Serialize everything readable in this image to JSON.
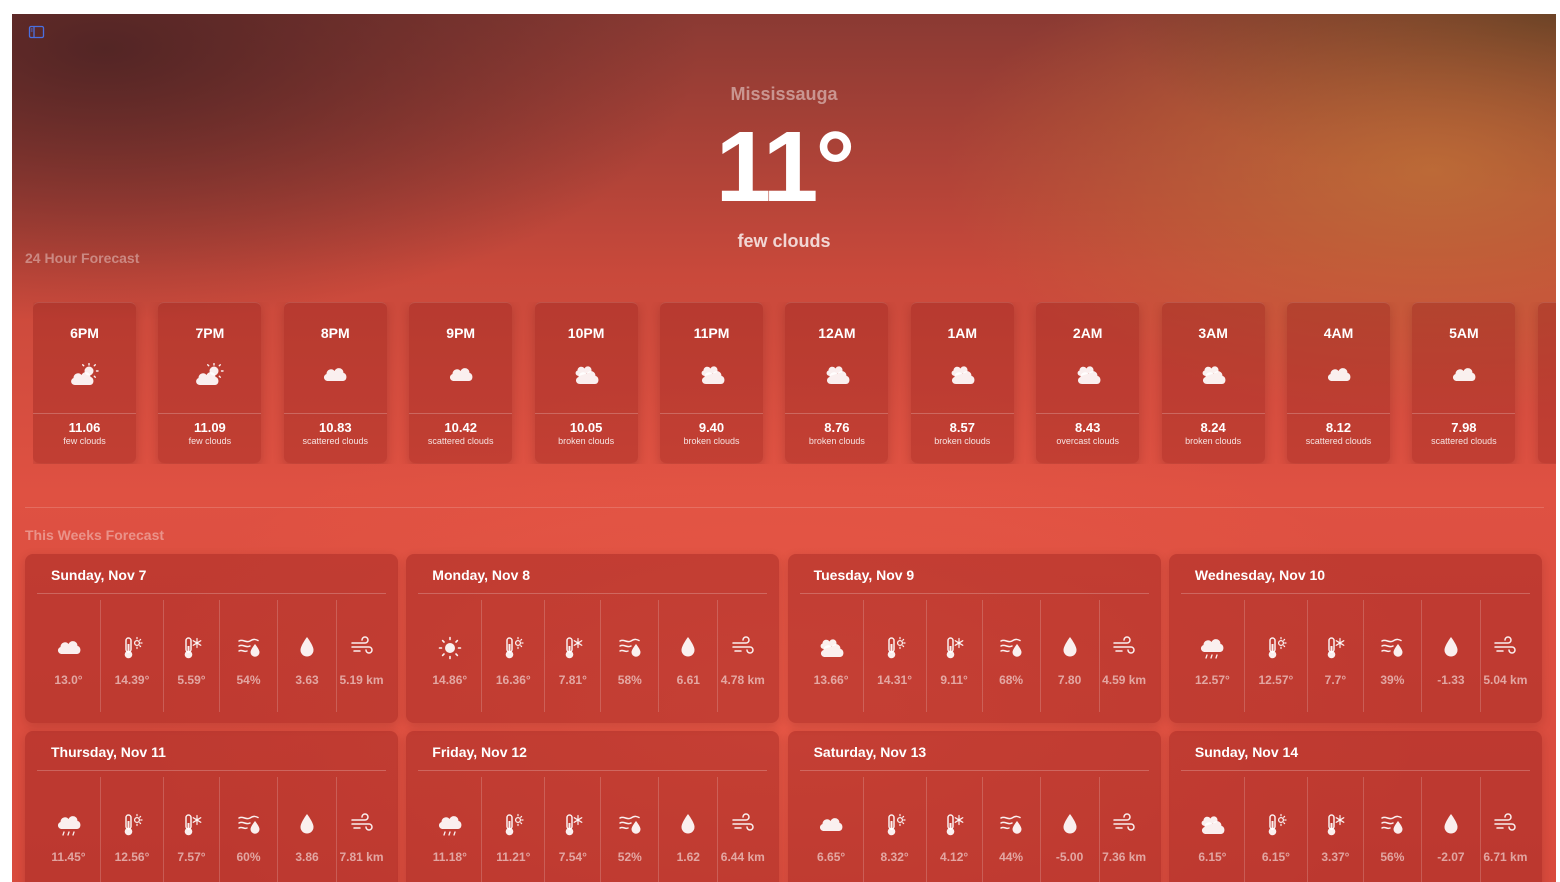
{
  "app": {
    "sidebar_toggle_icon": "sidebar-icon"
  },
  "current": {
    "city": "Mississauga",
    "temperature": "11°",
    "condition": "few clouds"
  },
  "sections": {
    "hourly_title": "24 Hour Forecast",
    "weekly_title": "This Weeks Forecast"
  },
  "hourly": [
    {
      "time": "6PM",
      "icon": "partly-cloudy",
      "temp": "11.06",
      "desc": "few clouds"
    },
    {
      "time": "7PM",
      "icon": "partly-cloudy",
      "temp": "11.09",
      "desc": "few clouds"
    },
    {
      "time": "8PM",
      "icon": "cloud",
      "temp": "10.83",
      "desc": "scattered clouds"
    },
    {
      "time": "9PM",
      "icon": "cloud",
      "temp": "10.42",
      "desc": "scattered clouds"
    },
    {
      "time": "10PM",
      "icon": "clouds",
      "temp": "10.05",
      "desc": "broken clouds"
    },
    {
      "time": "11PM",
      "icon": "clouds",
      "temp": "9.40",
      "desc": "broken clouds"
    },
    {
      "time": "12AM",
      "icon": "clouds",
      "temp": "8.76",
      "desc": "broken clouds"
    },
    {
      "time": "1AM",
      "icon": "clouds",
      "temp": "8.57",
      "desc": "broken clouds"
    },
    {
      "time": "2AM",
      "icon": "clouds",
      "temp": "8.43",
      "desc": "overcast clouds"
    },
    {
      "time": "3AM",
      "icon": "clouds",
      "temp": "8.24",
      "desc": "broken clouds"
    },
    {
      "time": "4AM",
      "icon": "cloud",
      "temp": "8.12",
      "desc": "scattered clouds"
    },
    {
      "time": "5AM",
      "icon": "cloud",
      "temp": "7.98",
      "desc": "scattered clouds"
    }
  ],
  "daily": [
    {
      "date": "Sunday, Nov 7",
      "icon": "cloud",
      "temp": "13.0°",
      "max": "14.39°",
      "min": "5.59°",
      "humidity": "54%",
      "dew": "3.63",
      "wind": "5.19 km"
    },
    {
      "date": "Monday, Nov 8",
      "icon": "sun",
      "temp": "14.86°",
      "max": "16.36°",
      "min": "7.81°",
      "humidity": "58%",
      "dew": "6.61",
      "wind": "4.78 km"
    },
    {
      "date": "Tuesday, Nov 9",
      "icon": "clouds",
      "temp": "13.66°",
      "max": "14.31°",
      "min": "9.11°",
      "humidity": "68%",
      "dew": "7.80",
      "wind": "4.59 km"
    },
    {
      "date": "Wednesday, Nov 10",
      "icon": "rain",
      "temp": "12.57°",
      "max": "12.57°",
      "min": "7.7°",
      "humidity": "39%",
      "dew": "-1.33",
      "wind": "5.04 km"
    },
    {
      "date": "Thursday, Nov 11",
      "icon": "rain",
      "temp": "11.45°",
      "max": "12.56°",
      "min": "7.57°",
      "humidity": "60%",
      "dew": "3.86",
      "wind": "7.81 km"
    },
    {
      "date": "Friday, Nov 12",
      "icon": "rain",
      "temp": "11.18°",
      "max": "11.21°",
      "min": "7.54°",
      "humidity": "52%",
      "dew": "1.62",
      "wind": "6.44 km"
    },
    {
      "date": "Saturday, Nov 13",
      "icon": "cloud",
      "temp": "6.65°",
      "max": "8.32°",
      "min": "4.12°",
      "humidity": "44%",
      "dew": "-5.00",
      "wind": "7.36 km"
    },
    {
      "date": "Sunday, Nov 14",
      "icon": "clouds",
      "temp": "6.15°",
      "max": "6.15°",
      "min": "3.37°",
      "humidity": "56%",
      "dew": "-2.07",
      "wind": "6.71 km"
    }
  ],
  "colors": {
    "accent": "#df5142",
    "dark": "#8a3a33",
    "warm": "#be6e37",
    "toggle": "#3a5fcf"
  }
}
